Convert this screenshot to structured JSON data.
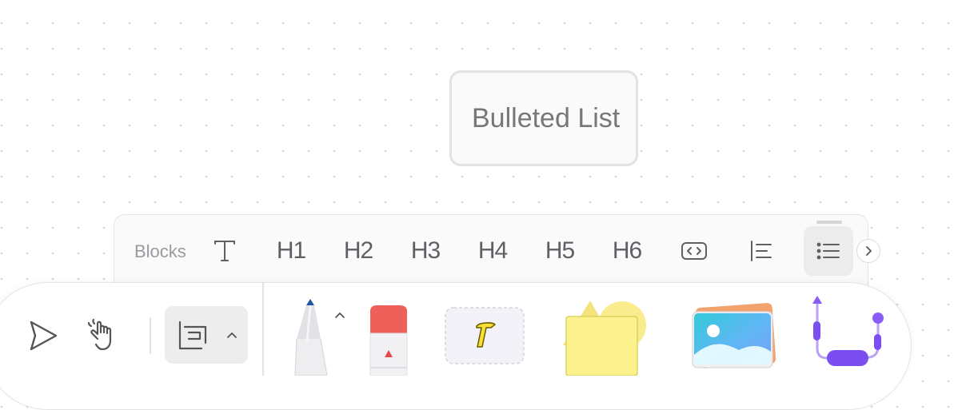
{
  "canvas": {
    "note_text": "Bulleted List"
  },
  "blocks_panel": {
    "label": "Blocks",
    "items": [
      {
        "id": "text",
        "label": ""
      },
      {
        "id": "h1",
        "label": "H1"
      },
      {
        "id": "h2",
        "label": "H2"
      },
      {
        "id": "h3",
        "label": "H3"
      },
      {
        "id": "h4",
        "label": "H4"
      },
      {
        "id": "h5",
        "label": "H5"
      },
      {
        "id": "h6",
        "label": "H6"
      },
      {
        "id": "code",
        "label": ""
      },
      {
        "id": "quote",
        "label": ""
      },
      {
        "id": "bulleted-list",
        "label": ""
      }
    ],
    "active_item": "bulleted-list"
  },
  "toolbar": {
    "tools": [
      "select",
      "hand",
      "frame",
      "pen",
      "eraser",
      "text",
      "note-shape",
      "image",
      "connector"
    ]
  },
  "colors": {
    "accent_purple": "#8a5cf5",
    "pen_blue": "#2456a8",
    "eraser_red": "#f0605a",
    "sticky_yellow": "#fbf28e"
  }
}
